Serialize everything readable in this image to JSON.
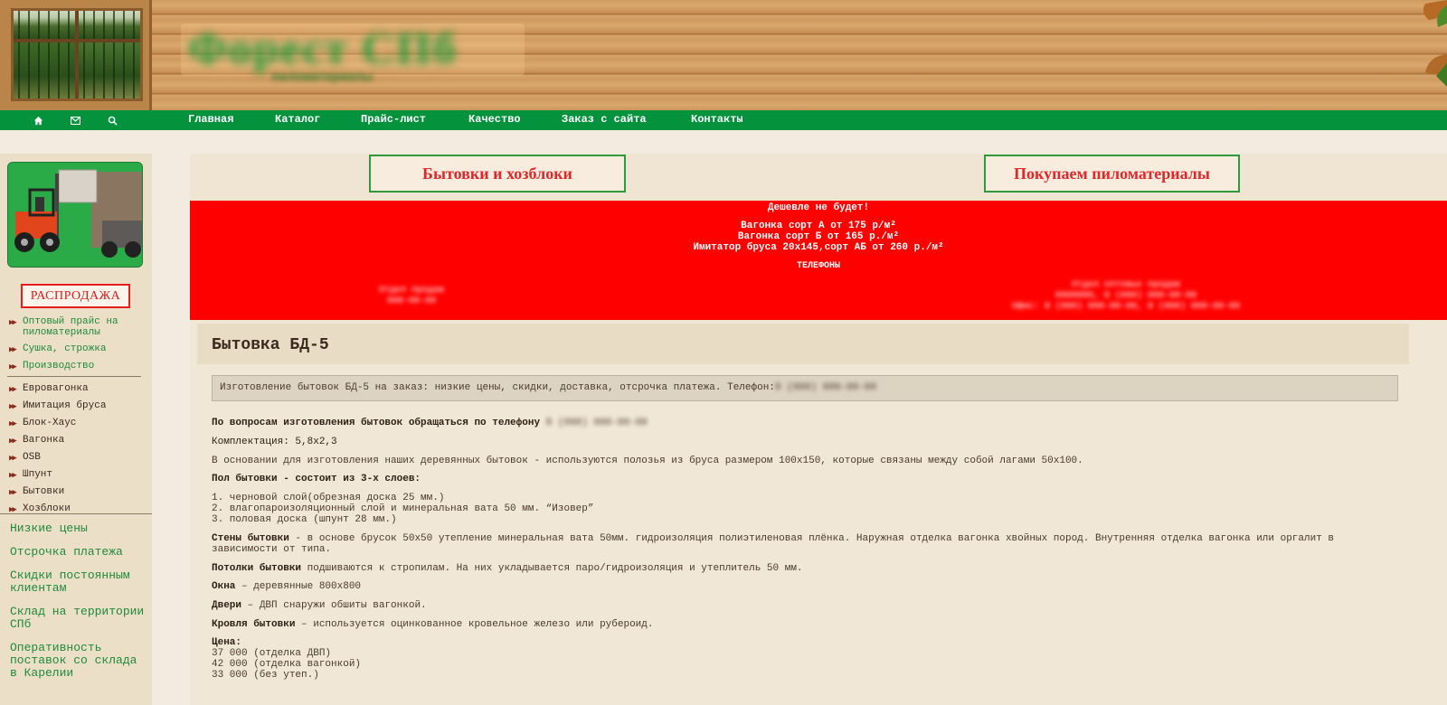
{
  "header": {
    "logo_text": "Форест СПб",
    "logo_subtitle": "пиломатериалы"
  },
  "nav": {
    "icons": [
      "home-icon",
      "mail-icon",
      "search-icon"
    ],
    "links": [
      "Главная",
      "Каталог",
      "Прайс-лист",
      "Качество",
      "Заказ с сайта",
      "Контакты"
    ]
  },
  "sidebar": {
    "sale_label": "РАСПРОДАЖА",
    "top_links": [
      "Оптовый прайс на пиломатериалы",
      "Сушка, строжка",
      "Производство"
    ],
    "catalog_links": [
      "Евровагонка",
      "Имитация бруса",
      "Блок-Хаус",
      "Вагонка",
      "OSB",
      "Шпунт",
      "Бытовки",
      "Хозблоки"
    ],
    "features": [
      "Низкие цены",
      "Отсрочка платежа",
      "Скидки постоянным клиентам",
      "Склад на территории СПб",
      "Оперативность поставок со склада в Карелии"
    ]
  },
  "promo": {
    "left": "Бытовки и хозблоки",
    "right": "Покупаем пиломатериалы"
  },
  "banner": {
    "headline": "Дешевле не будет!",
    "price_lines": [
      "Вагонка сорт А от 175 р/м²",
      "Вагонка сорт Б от 165 р./м²",
      "Имитатор бруса 20х145,сорт АБ от 260 р./м²"
    ],
    "phones_label": "ТЕЛЕФОНЫ",
    "left_contact": [
      "Отдел продаж",
      "000-00-00"
    ],
    "right_contact": [
      "Отдел оптовых продаж",
      "0000000, 8 (000) 000-00-00",
      "Офис: 8 (000) 000-00-00, 8 (000) 000-00-00"
    ]
  },
  "article": {
    "title": "Бытовка БД-5",
    "lead": "Изготовление бытовок БД-5 на заказ: низкие цены, скидки, доставка, отсрочка платежа. Телефон:",
    "lead_phone": "8 (000) 000-00-00",
    "contact_bold": "По вопросам изготовления бытовок обращаться по телефону",
    "contact_phone": "8 (000) 000-00-00",
    "kit": "Комплектация: 5,8х2,3",
    "base": "В основании для изготовления наших деревянных бытовок - используются полозья из бруса размером 100х150, которые связаны между собой лагами 50х100.",
    "floor_heading": "Пол бытовки - состоит из 3-х слоев:",
    "floor_layers": [
      "1. черновой слой(обрезная доска 25 мм.)",
      "2. влагопароизоляционный слой и минеральная вата 50 мм. “Изовер”",
      "3. половая доска (шпунт 28 мм.)"
    ],
    "walls_bold": "Стены бытовки",
    "walls_text": " - в основе брусок 50х50 утепление минеральная вата 50мм. гидроизоляция полиэтиленовая плёнка. Наружная отделка вагонка хвойных пород. Внутренняя отделка вагонка или оргалит в",
    "walls_text2": "зависимости от типа.",
    "ceiling_bold": "Потолки бытовки",
    "ceiling_text": " подшиваются к стропилам. На них укладывается паро/гидроизоляция и утеплитель 50 мм.",
    "windows_bold": "Окна",
    "windows_text": " – деревянные 800х800",
    "doors_bold": "Двери",
    "doors_text": " – ДВП снаружи обшиты вагонкой.",
    "roof_bold": "Кровля бытовки",
    "roof_text": " – используется оцинкованное кровельное железо или рубероид.",
    "price_label": "Цена:",
    "prices": [
      "37 000 (отделка ДВП)",
      "42 000 (отделка вагонкой)",
      "33 000 (без утеп.)"
    ]
  }
}
